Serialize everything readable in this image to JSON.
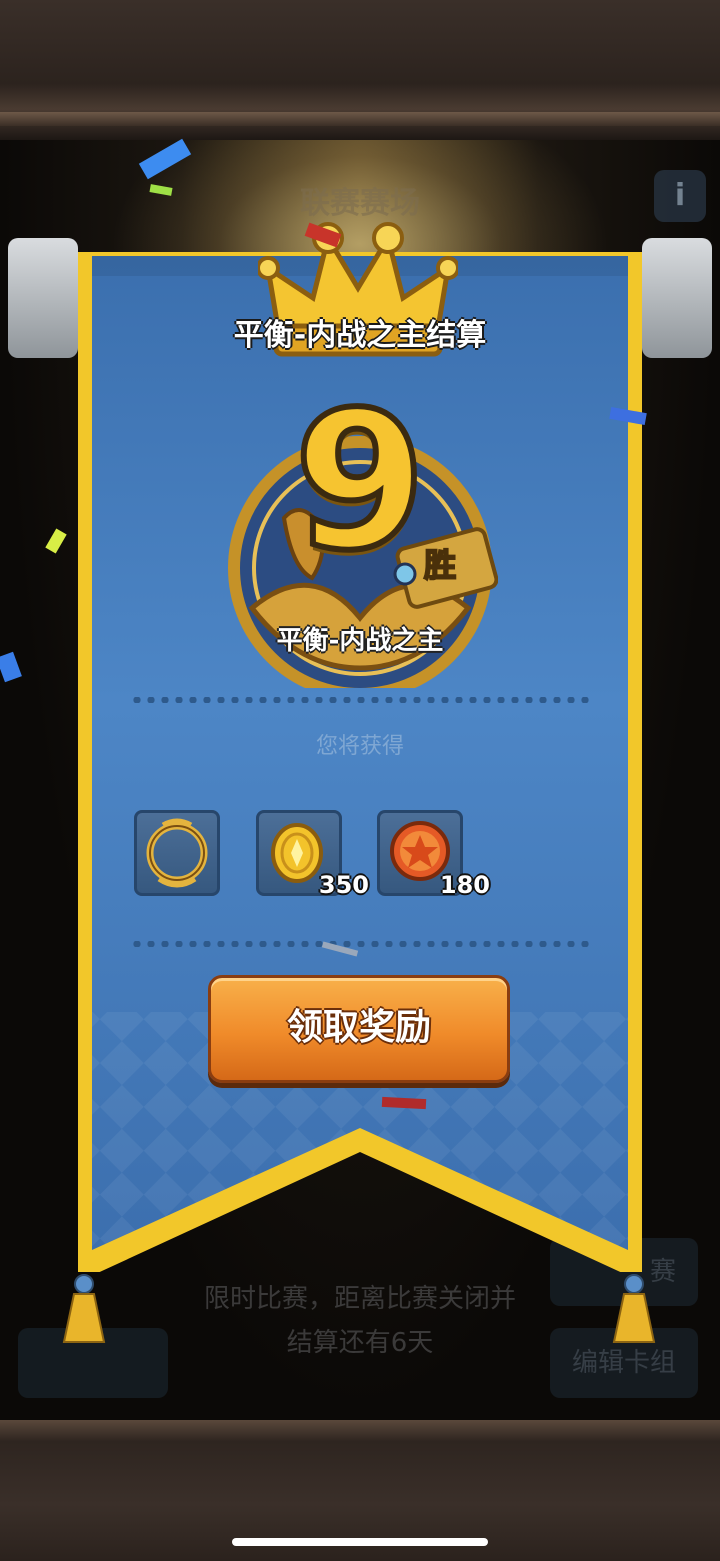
{
  "background": {
    "arena_title": "联赛赛场",
    "info_icon": "info-icon",
    "notice_line1": "限时比赛，距离比赛关闭并",
    "notice_line2": "结算还有6天",
    "right_button_1": "赛",
    "right_button_2": "编辑卡组"
  },
  "popup": {
    "title": "平衡-内战之主结算",
    "wins_value": "9",
    "wins_unit": "胜",
    "medal_name": "平衡-内战之主",
    "reward_header": "您将获得",
    "rewards": [
      {
        "icon": "golden-frame-icon",
        "count": ""
      },
      {
        "icon": "gold-coin-icon",
        "count": "350"
      },
      {
        "icon": "star-badge-icon",
        "count": "180"
      }
    ],
    "claim_label": "领取奖励"
  },
  "colors": {
    "banner_blue": "#3d73b4",
    "banner_border": "#f2c72a",
    "claim_orange": "#f08b2a",
    "gold": "#f6c430"
  }
}
